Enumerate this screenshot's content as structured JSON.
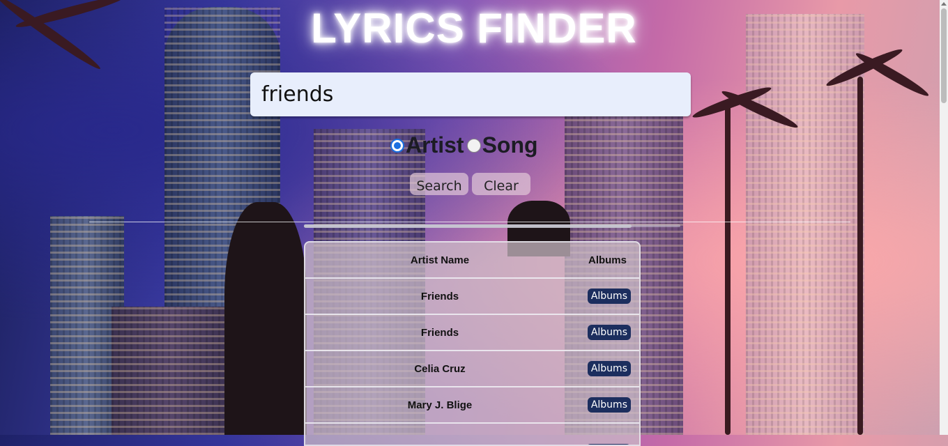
{
  "header": {
    "title": "LYRICS FINDER"
  },
  "search": {
    "value": "friends"
  },
  "search_type": {
    "options": [
      {
        "label": "Artist",
        "selected": true
      },
      {
        "label": "Song",
        "selected": false
      }
    ]
  },
  "actions": {
    "search_label": "Search",
    "clear_label": "Clear"
  },
  "results": {
    "columns": {
      "name": "Artist Name",
      "albums": "Albums"
    },
    "rows": [
      {
        "name": "Friends",
        "button": "Albums"
      },
      {
        "name": "Friends",
        "button": "Albums"
      },
      {
        "name": "Celia Cruz",
        "button": "Albums"
      },
      {
        "name": "Mary J. Blige",
        "button": "Albums"
      },
      {
        "name": "",
        "button": ""
      }
    ]
  },
  "colors": {
    "accent": "#1a6fe0",
    "albums_button": "#1c2e5e",
    "input_bg": "#e8eefc"
  }
}
